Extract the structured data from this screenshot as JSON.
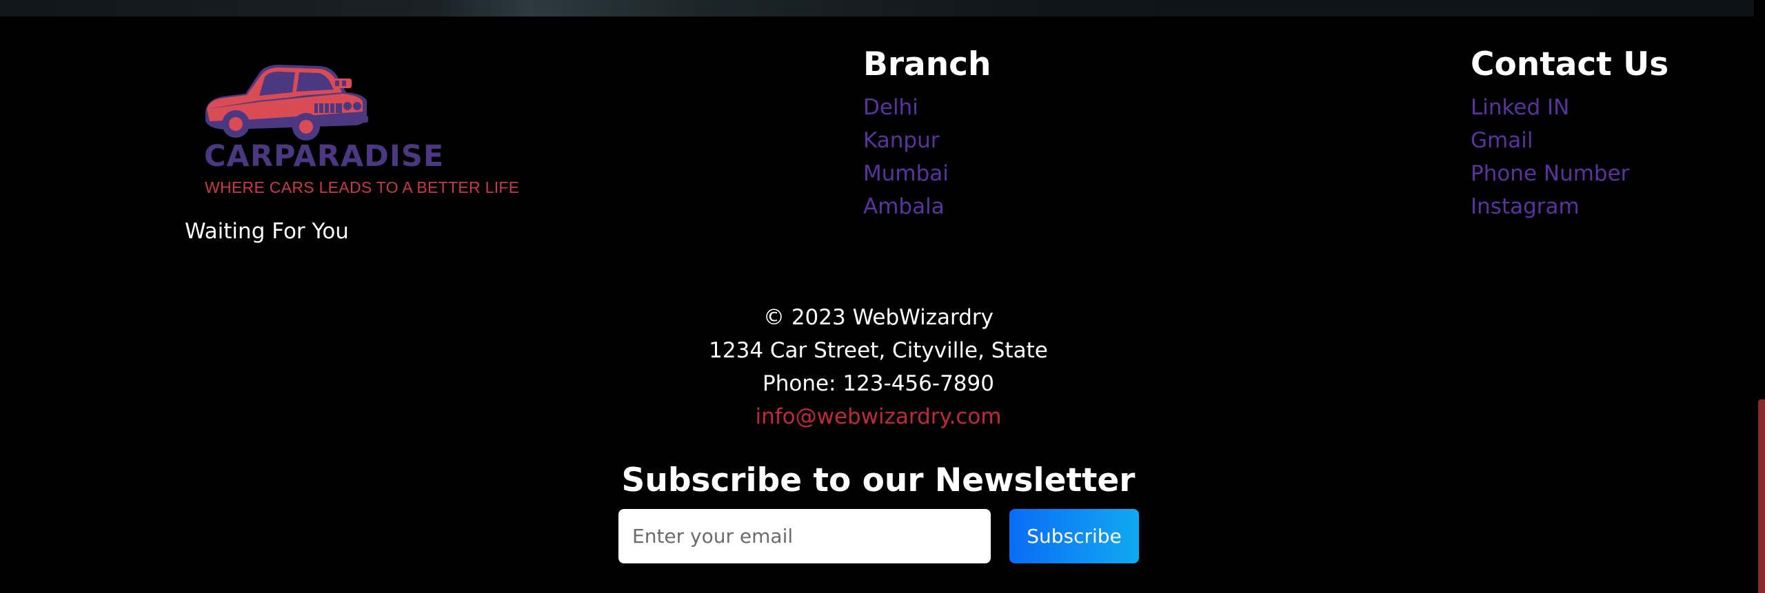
{
  "brand": {
    "name": "CARPARADISE",
    "tagline": "WHERE CARS LEADS TO A BETTER LIFE",
    "caption": "Waiting For You",
    "colors": {
      "name": "#4b3880",
      "tagline": "#c8394a",
      "car_body": "#d94b55",
      "car_dark": "#4b3880"
    }
  },
  "branch": {
    "title": "Branch",
    "items": [
      "Delhi",
      "Kanpur",
      "Mumbai",
      "Ambala"
    ]
  },
  "contact": {
    "title": "Contact Us",
    "items": [
      "Linked IN",
      "Gmail",
      "Phone Number",
      "Instagram"
    ]
  },
  "info": {
    "copyright": "© 2023 WebWizardry",
    "address": "1234 Car Street, Cityville, State",
    "phone": "Phone: 123-456-7890",
    "email": "info@webwizardry.com"
  },
  "newsletter": {
    "title": "Subscribe to our Newsletter",
    "placeholder": "Enter your email",
    "button_label": "Subscribe"
  },
  "colors": {
    "background": "#000000",
    "link": "#5b33a0",
    "email_link": "#c0293a",
    "button_gradient_start": "#0a6cf5",
    "button_gradient_end": "#11a9f2"
  }
}
